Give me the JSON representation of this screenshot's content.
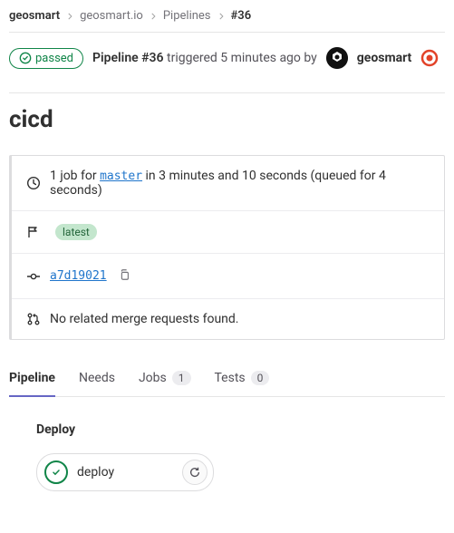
{
  "breadcrumbs": {
    "root": "geosmart",
    "project": "geosmart.io",
    "pipelines": "Pipelines",
    "current": "#36"
  },
  "header": {
    "status_label": "passed",
    "pipeline_title": "Pipeline #36",
    "triggered_text": " triggered 5 minutes ago by ",
    "username": "geosmart"
  },
  "page_title": "cicd",
  "info": {
    "job_prefix": "1 job for ",
    "branch": "master",
    "job_suffix": " in 3 minutes and 10 seconds (queued for 4 seconds)",
    "latest_tag": "latest",
    "sha": "a7d19021",
    "mr_text": "No related merge requests found."
  },
  "tabs": {
    "pipeline": "Pipeline",
    "needs": "Needs",
    "jobs": "Jobs",
    "jobs_count": "1",
    "tests": "Tests",
    "tests_count": "0"
  },
  "stage": {
    "name": "Deploy",
    "job_name": "deploy"
  }
}
